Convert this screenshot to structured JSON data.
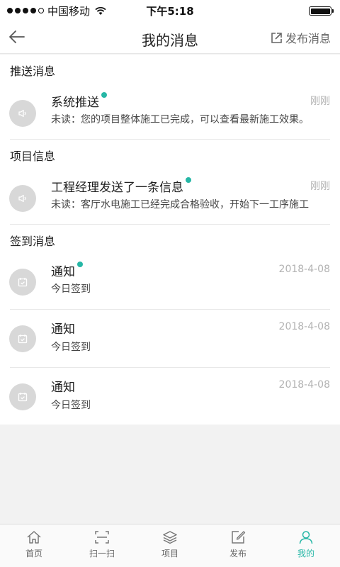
{
  "status_bar": {
    "carrier": "中国移动",
    "time": "下午5:18"
  },
  "nav": {
    "title": "我的消息",
    "publish_label": "发布消息"
  },
  "sections": [
    {
      "title": "推送消息",
      "items": [
        {
          "title": "系统推送",
          "time": "刚刚",
          "body": "未读：您的项目整体施工已完成，可以查看最新施工效果。",
          "unread": true,
          "icon": "speaker-icon"
        }
      ]
    },
    {
      "title": "项目信息",
      "items": [
        {
          "title": "工程经理发送了一条信息",
          "time": "刚刚",
          "body": "未读：客厅水电施工已经完成合格验收，开始下一工序施工",
          "unread": true,
          "icon": "speaker-icon"
        }
      ]
    },
    {
      "title": "签到消息",
      "items": [
        {
          "title": "通知",
          "time": "2018-4-08",
          "body": "今日签到",
          "unread": true,
          "icon": "calendar-check-icon"
        },
        {
          "title": "通知",
          "time": "2018-4-08",
          "body": "今日签到",
          "unread": false,
          "icon": "calendar-check-icon"
        },
        {
          "title": "通知",
          "time": "2018-4-08",
          "body": "今日签到",
          "unread": false,
          "icon": "calendar-check-icon"
        }
      ]
    }
  ],
  "tabs": [
    {
      "label": "首页",
      "icon": "home-icon",
      "active": false
    },
    {
      "label": "扫一扫",
      "icon": "scan-icon",
      "active": false
    },
    {
      "label": "项目",
      "icon": "layers-icon",
      "active": false
    },
    {
      "label": "发布",
      "icon": "edit-icon",
      "active": false
    },
    {
      "label": "我的",
      "icon": "user-icon",
      "active": true
    }
  ],
  "colors": {
    "accent": "#26b7a6",
    "avatar_bg": "#d8d8d8",
    "muted_text": "#b2b2b2"
  }
}
